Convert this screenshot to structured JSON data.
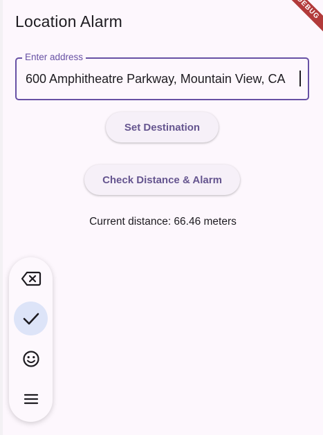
{
  "app": {
    "title": "Location Alarm",
    "debug_banner": "DEBUG"
  },
  "address_field": {
    "label": "Enter address",
    "value": "600 Amphitheatre Parkway, Mountain View, CA"
  },
  "buttons": {
    "set_destination": "Set Destination",
    "check_distance": "Check Distance & Alarm"
  },
  "status": {
    "distance_text": "Current distance: 66.46 meters"
  },
  "keyboard_toolbar": {
    "items": [
      {
        "icon": "backspace-icon"
      },
      {
        "icon": "check-icon",
        "active": true
      },
      {
        "icon": "emoji-icon"
      },
      {
        "icon": "menu-icon"
      }
    ]
  },
  "colors": {
    "accent": "#6750a4",
    "button_text": "#65558f",
    "background": "#fdf7fd"
  }
}
